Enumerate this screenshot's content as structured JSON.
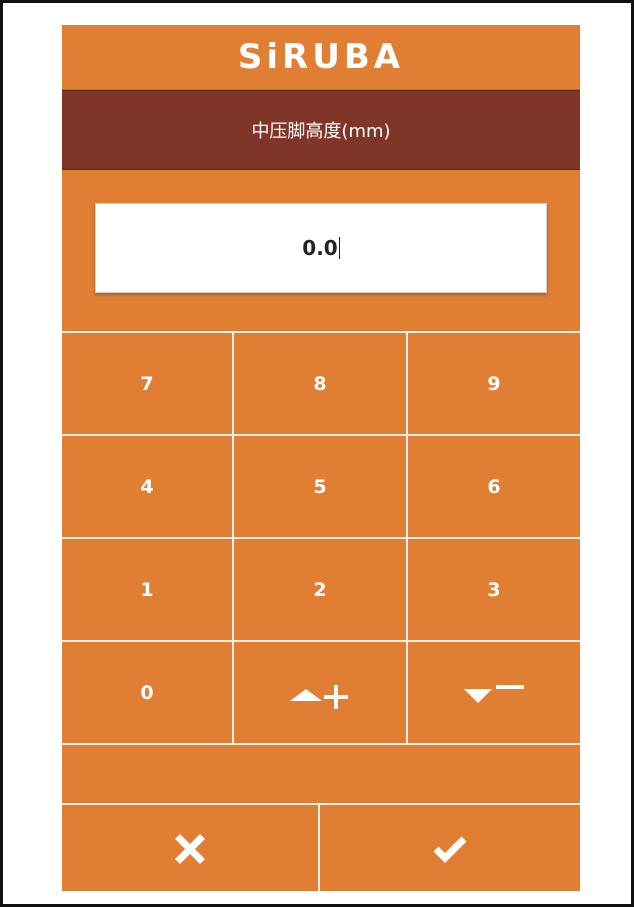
{
  "brand": {
    "logo_text": "SiRUBA"
  },
  "dialog": {
    "title": "中压脚高度(mm)"
  },
  "input": {
    "value": "0.0"
  },
  "keypad": {
    "keys": [
      "7",
      "8",
      "9",
      "4",
      "5",
      "6",
      "1",
      "2",
      "3",
      "0"
    ],
    "increment_icon": "triangle-up-plus-icon",
    "decrement_icon": "triangle-down-minus-icon"
  },
  "actions": {
    "cancel_icon": "close-icon",
    "confirm_icon": "check-icon"
  },
  "colors": {
    "panel": "#e07e33",
    "title_bar": "#7f3628",
    "text": "#ffffff"
  }
}
